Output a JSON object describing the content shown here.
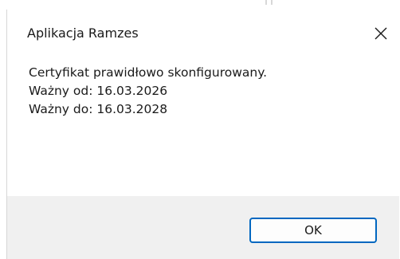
{
  "window": {
    "title": "Aplikacja Ramzes",
    "close_icon": "close-icon"
  },
  "message": {
    "line1": "Certyfikat prawidłowo skonfigurowany.",
    "line2": "Ważny od: 16.03.2026",
    "line3": "Ważny do: 16.03.2028"
  },
  "buttons": {
    "ok_label": "OK"
  },
  "colors": {
    "accent": "#0067c0",
    "footer_bg": "#f0f0f0",
    "text": "#1a1a1a"
  }
}
